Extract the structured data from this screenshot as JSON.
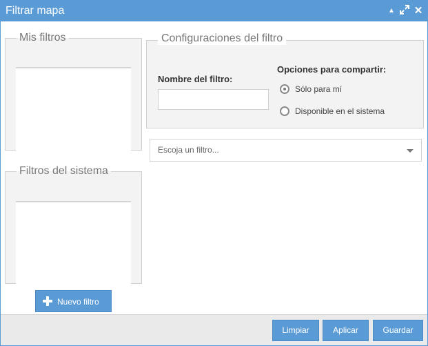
{
  "window": {
    "title": "Filtrar mapa"
  },
  "mis_filtros": {
    "legend": "Mis filtros"
  },
  "filtros_sistema": {
    "legend": "Filtros del sistema"
  },
  "config": {
    "legend": "Configuraciones del filtro",
    "nombre_label": "Nombre del filtro:",
    "nombre_value": "",
    "opciones_label": "Opciones para compartir:",
    "options": [
      {
        "label": "Sólo para mí",
        "selected": true
      },
      {
        "label": "Disponible en el sistema",
        "selected": false
      }
    ]
  },
  "select": {
    "placeholder": "Escoja un filtro..."
  },
  "buttons": {
    "nuevo": "Nuevo filtro",
    "limpiar": "Limpiar",
    "aplicar": "Aplicar",
    "guardar": "Guardar"
  },
  "colors": {
    "accent": "#5b9bd5",
    "panel": "#f3f3f3"
  }
}
